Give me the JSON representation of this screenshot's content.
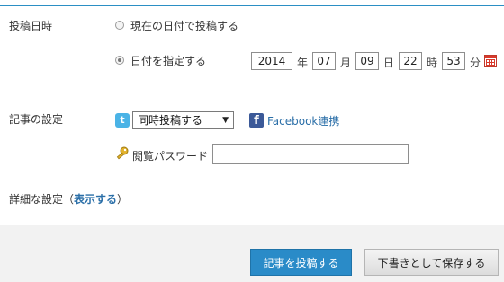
{
  "post_datetime": {
    "label": "投稿日時",
    "option_now": "現在の日付で投稿する",
    "option_specify": "日付を指定する",
    "selected": "specify",
    "year": "2014",
    "year_unit": "年",
    "month": "07",
    "month_unit": "月",
    "day": "09",
    "day_unit": "日",
    "hour": "22",
    "hour_unit": "時",
    "minute": "53",
    "minute_unit": "分"
  },
  "article_settings": {
    "label": "記事の設定",
    "share_select_value": "同時投稿する",
    "facebook_link": "Facebook連携",
    "password_label": "閲覧パスワード",
    "password_value": ""
  },
  "details": {
    "label": "詳細な設定（",
    "toggle": "表示する",
    "close_paren": "）"
  },
  "footer": {
    "publish_button": "記事を投稿する",
    "draft_button": "下書きとして保存する"
  },
  "colors": {
    "accent": "#2a8bc8",
    "link": "#2b6fa8",
    "facebook": "#3b5998",
    "twitter": "#4ab3e6"
  },
  "icons": {
    "twitter": "twitter-icon",
    "facebook": "facebook-icon",
    "key": "key-icon",
    "calendar": "calendar-icon"
  }
}
